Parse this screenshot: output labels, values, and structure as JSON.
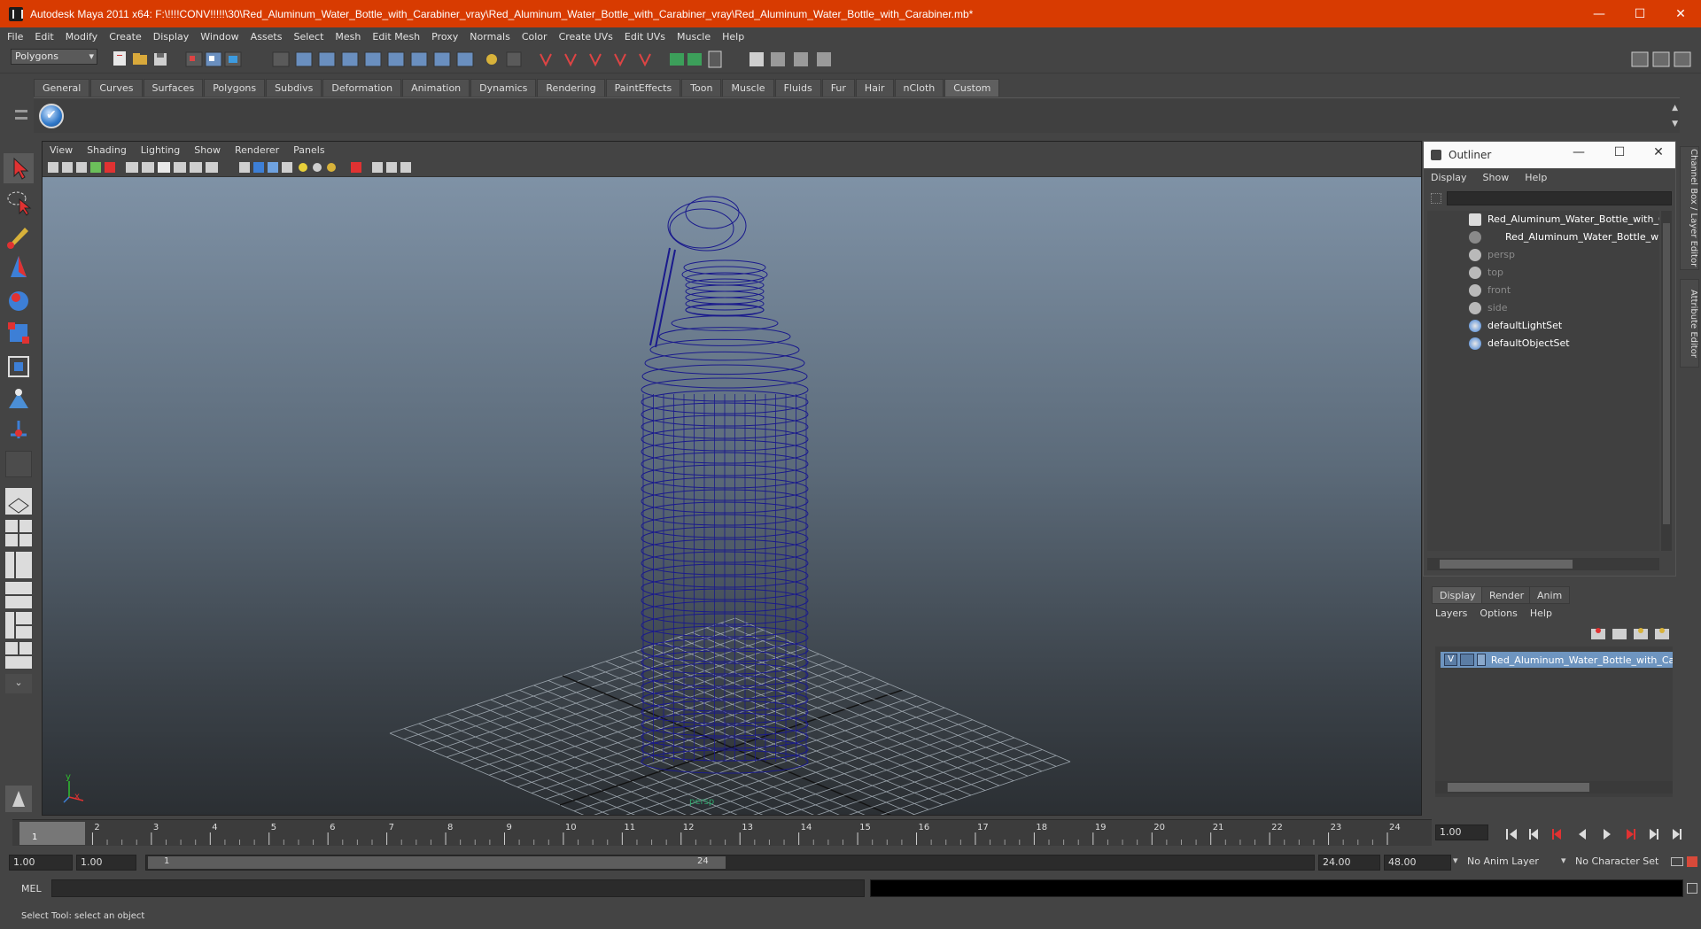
{
  "window": {
    "title": "Autodesk Maya 2011 x64: F:\\!!!!CONV!!!!!\\30\\Red_Aluminum_Water_Bottle_with_Carabiner_vray\\Red_Aluminum_Water_Bottle_with_Carabiner_vray\\Red_Aluminum_Water_Bottle_with_Carabiner.mb*",
    "minimize": "—",
    "maximize": "☐",
    "close": "✕"
  },
  "menubar": [
    "File",
    "Edit",
    "Modify",
    "Create",
    "Display",
    "Window",
    "Assets",
    "Select",
    "Mesh",
    "Edit Mesh",
    "Proxy",
    "Normals",
    "Color",
    "Create UVs",
    "Edit UVs",
    "Muscle",
    "Help"
  ],
  "statusline": {
    "mode": "Polygons"
  },
  "shelf": {
    "tabs": [
      "General",
      "Curves",
      "Surfaces",
      "Polygons",
      "Subdivs",
      "Deformation",
      "Animation",
      "Dynamics",
      "Rendering",
      "PaintEffects",
      "Toon",
      "Muscle",
      "Fluids",
      "Fur",
      "Hair",
      "nCloth",
      "Custom"
    ],
    "active_tab": "Custom"
  },
  "viewport": {
    "menu": [
      "View",
      "Shading",
      "Lighting",
      "Show",
      "Renderer",
      "Panels"
    ],
    "camera_label": "persp",
    "axis_x": "x",
    "axis_y": "y",
    "wire_color": "#1a1a8c"
  },
  "outliner": {
    "title": "Outliner",
    "menu": [
      "Display",
      "Show",
      "Help"
    ],
    "items": [
      {
        "label": "Red_Aluminum_Water_Bottle_with_Carabiner",
        "color": "#ffffff"
      },
      {
        "label": "Red_Aluminum_Water_Bottle_with_Carabiner",
        "color": "#ffffff"
      },
      {
        "label": "persp",
        "color": "#8a8a8a"
      },
      {
        "label": "top",
        "color": "#8a8a8a"
      },
      {
        "label": "front",
        "color": "#8a8a8a"
      },
      {
        "label": "side",
        "color": "#8a8a8a"
      },
      {
        "label": "defaultLightSet",
        "color": "#ffffff"
      },
      {
        "label": "defaultObjectSet",
        "color": "#ffffff"
      }
    ]
  },
  "layer_editor": {
    "tabs": [
      "Display",
      "Render",
      "Anim"
    ],
    "menu": [
      "Layers",
      "Options",
      "Help"
    ],
    "layer": {
      "visible": "V",
      "name": "Red_Aluminum_Water_Bottle_with_Carabiner"
    }
  },
  "side_tabs": [
    "Channel Box / Layer Editor",
    "Attribute Editor"
  ],
  "timeline": {
    "ticks": [
      "1",
      "2",
      "3",
      "4",
      "5",
      "6",
      "7",
      "8",
      "9",
      "10",
      "11",
      "12",
      "13",
      "14",
      "15",
      "16",
      "17",
      "18",
      "19",
      "20",
      "21",
      "22",
      "23",
      "24"
    ],
    "current_frame": "1",
    "current_time_field": "1.00"
  },
  "range": {
    "start": "1.00",
    "playback_start": "1.00",
    "slider_start": "1",
    "slider_end": "24",
    "playback_end": "24.00",
    "end": "48.00",
    "anim_layer": "No Anim Layer",
    "character_set": "No Character Set"
  },
  "cmdline": {
    "label": "MEL"
  },
  "helpline": {
    "text": "Select Tool: select an object"
  }
}
